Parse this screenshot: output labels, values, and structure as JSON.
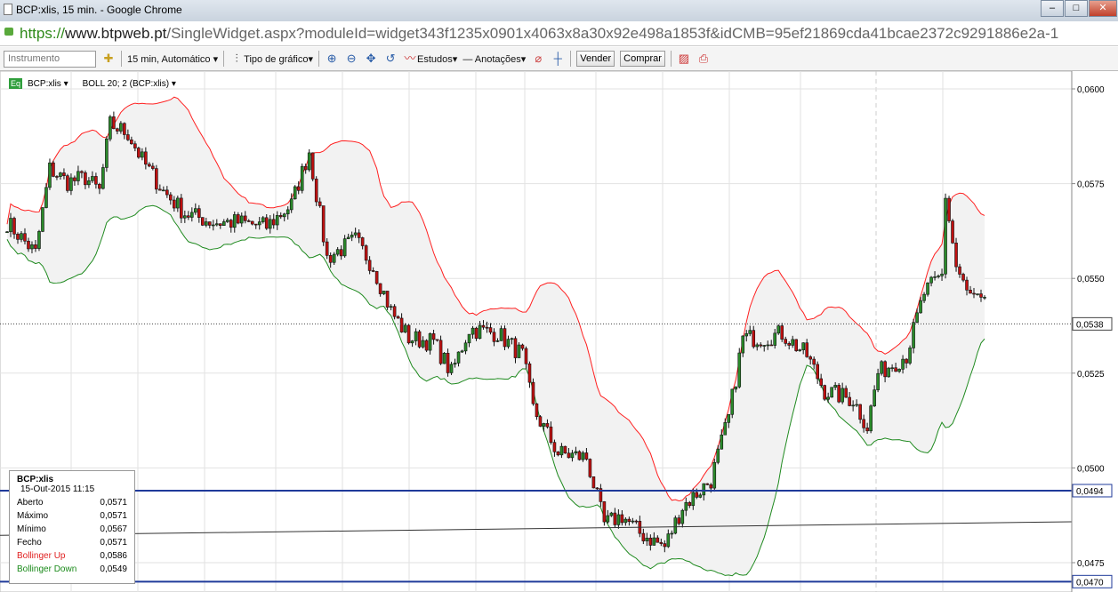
{
  "window": {
    "title": "BCP:xlis, 15 min. - Google Chrome",
    "url_scheme": "https://",
    "url_domain": "www.btpweb.pt",
    "url_path": "/SingleWidget.aspx?moduleId=widget343f1235x0901x4063x8a30x92e498a1853f&idCMB=95ef21869cda41bcae2372c9291886e2a-1"
  },
  "toolbar": {
    "instrument_placeholder": "Instrumento",
    "interval": "15 min, Automático",
    "chart_type": "Tipo de gráfico",
    "studies": "Estudos",
    "annotations": "Anotações",
    "sell": "Vender",
    "buy": "Comprar"
  },
  "legend": {
    "eq": "Eq",
    "instrument": "BCP:xlis ▾",
    "study": "BOLL 20; 2 (BCP:xlis) ▾"
  },
  "info_box": {
    "symbol": "BCP:xlis",
    "datetime": "15-Out-2015 11:15",
    "rows": [
      {
        "label": "Aberto",
        "value": "0,0571",
        "color": "#000000"
      },
      {
        "label": "Máximo",
        "value": "0,0571",
        "color": "#000000"
      },
      {
        "label": "Mínimo",
        "value": "0,0567",
        "color": "#000000"
      },
      {
        "label": "Fecho",
        "value": "0,0571",
        "color": "#000000"
      },
      {
        "label": "Bollinger Up",
        "value": "0,0586",
        "color": "#e02020"
      },
      {
        "label": "Bollinger Down",
        "value": "0,0549",
        "color": "#1a8a1a"
      }
    ]
  },
  "chart_data": {
    "type": "candlestick",
    "ylim": [
      0.04685,
      0.06025
    ],
    "y_ticks": [
      "0,0600",
      "0,0575",
      "0,0550",
      "0,0525",
      "0,0500",
      "0,0475"
    ],
    "y_tick_values": [
      0.06,
      0.0575,
      0.055,
      0.0525,
      0.05,
      0.0475
    ],
    "candle_count": 276,
    "close_path": {
      "index": [
        0,
        8,
        12,
        17,
        22,
        26,
        29,
        34,
        38,
        44,
        50,
        58,
        65,
        73,
        80,
        85,
        90,
        98,
        103,
        108,
        113,
        120,
        125,
        130,
        138,
        145,
        148,
        155,
        163,
        168,
        173,
        178,
        185,
        190,
        198,
        203,
        207,
        213,
        218,
        225,
        230,
        238,
        242,
        245,
        253,
        258,
        263,
        264,
        267,
        270,
        275
      ],
      "price": [
        0.05648,
        0.05566,
        0.05789,
        0.05754,
        0.05766,
        0.0573,
        0.05906,
        0.05883,
        0.05812,
        0.0573,
        0.05672,
        0.05648,
        0.05648,
        0.05637,
        0.05695,
        0.05836,
        0.05554,
        0.05601,
        0.05531,
        0.05414,
        0.05343,
        0.05332,
        0.0525,
        0.05367,
        0.05355,
        0.05297,
        0.05156,
        0.05039,
        0.05027,
        0.04851,
        0.04874,
        0.04828,
        0.04792,
        0.04898,
        0.04968,
        0.05132,
        0.05343,
        0.05343,
        0.05355,
        0.05297,
        0.05203,
        0.0518,
        0.05109,
        0.0525,
        0.05297,
        0.05461,
        0.05508,
        0.05719,
        0.05531,
        0.05461,
        0.05426
      ]
    },
    "bollinger": {
      "period": 20,
      "std": 2,
      "up_color": "#ff2020",
      "down_color": "#1f8a1f"
    },
    "last_price": {
      "value": 0.0538,
      "label": "0,0538"
    },
    "hlines": [
      {
        "value": 0.0494,
        "label": "0,0494",
        "color": "#1f3a9a"
      },
      {
        "value": 0.047,
        "label": "0,0470",
        "color": "#1f3a9a"
      }
    ],
    "trendline": {
      "from": 0.04822,
      "to": 0.04858,
      "color": "#333333"
    }
  }
}
